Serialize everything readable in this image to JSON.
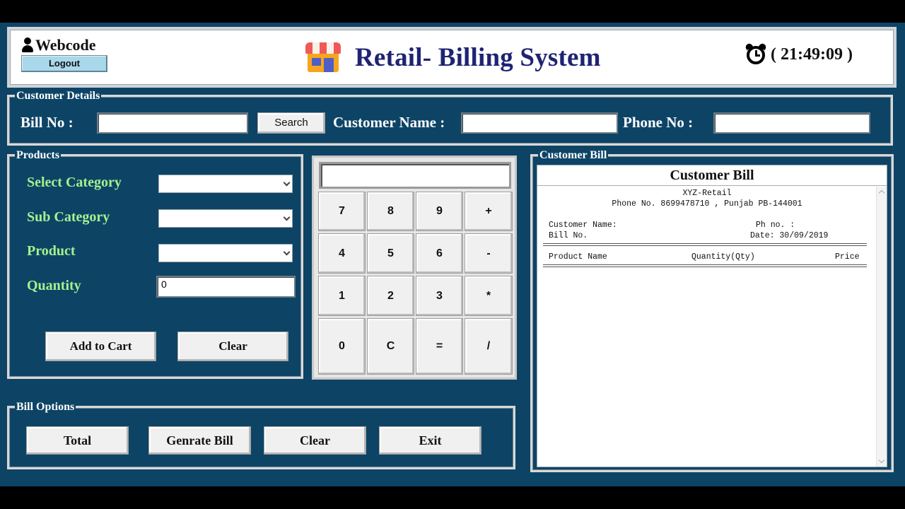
{
  "header": {
    "username": "Webcode",
    "logout_label": "Logout",
    "title": "Retail- Billing System",
    "clock": "( 21:49:09 )"
  },
  "customer": {
    "section_title": "Customer Details",
    "bill_no_label": "Bill No :",
    "bill_no_value": "",
    "search_label": "Search",
    "name_label": "Customer Name :",
    "name_value": "",
    "phone_label": "Phone No :",
    "phone_value": ""
  },
  "products": {
    "section_title": "Products",
    "category_label": "Select Category",
    "category_value": "",
    "subcategory_label": "Sub Category",
    "subcategory_value": "",
    "product_label": "Product",
    "product_value": "",
    "quantity_label": "Quantity",
    "quantity_value": "0",
    "add_to_cart_label": "Add to Cart",
    "clear_label": "Clear"
  },
  "calculator": {
    "display": "",
    "keys": [
      "7",
      "8",
      "9",
      "+",
      "4",
      "5",
      "6",
      "-",
      "1",
      "2",
      "3",
      "*",
      "0",
      "C",
      "=",
      "/"
    ]
  },
  "bill": {
    "section_title": "Customer Bill",
    "heading": "Customer Bill",
    "shop_name": "XYZ-Retail",
    "shop_phone": "Phone No. 8699478710 , Punjab PB-144001",
    "customer_name_label": "Customer Name:",
    "ph_no_label": "Ph no. :",
    "bill_no_label": "Bill No.",
    "date_label": "Date: 30/09/2019",
    "col_product": "Product Name",
    "col_qty": "Quantity(Qty)",
    "col_price": "Price"
  },
  "bill_options": {
    "section_title": "Bill Options",
    "total_label": "Total",
    "generate_label": "Genrate Bill",
    "clear_label": "Clear",
    "exit_label": "Exit"
  }
}
